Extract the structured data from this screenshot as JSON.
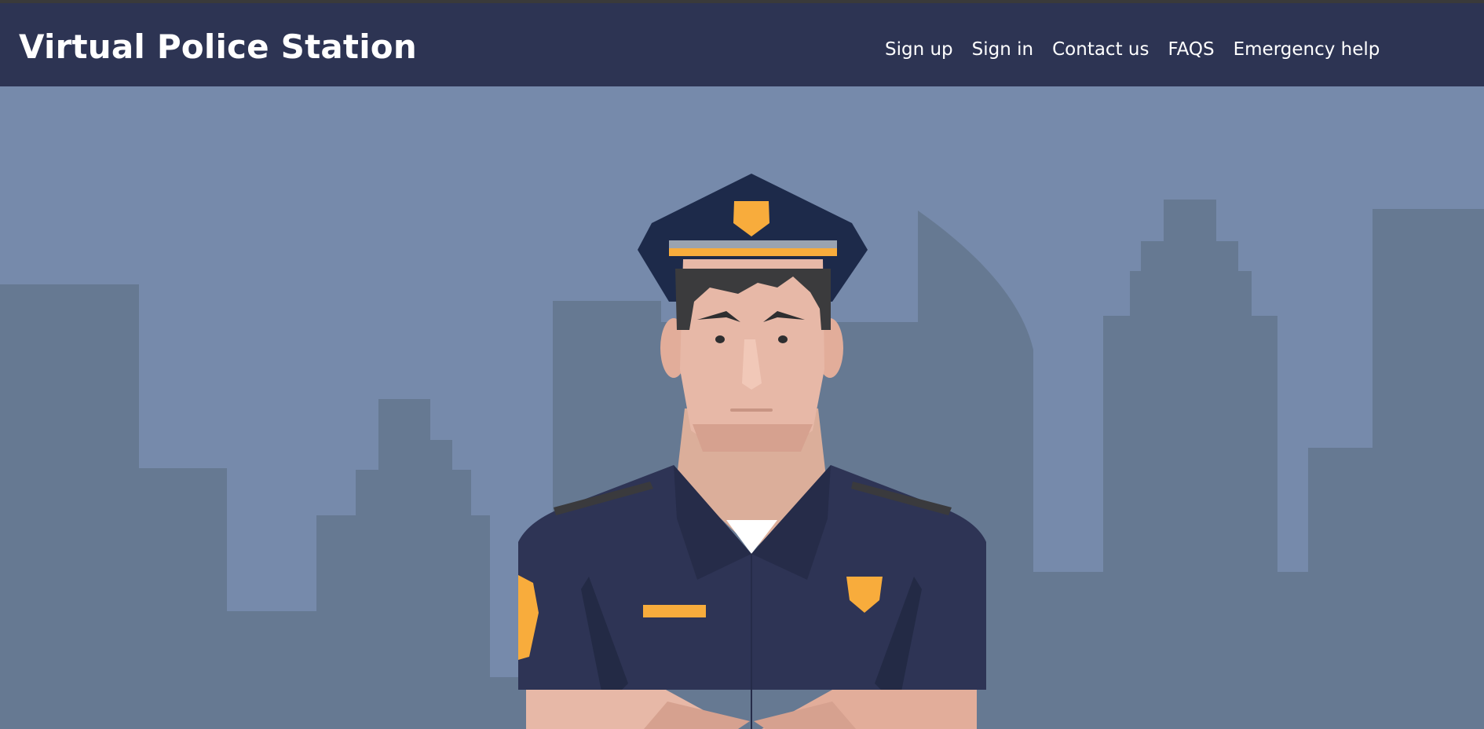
{
  "header": {
    "brand": "Virtual Police Station",
    "nav_links": [
      {
        "label": "Sign up"
      },
      {
        "label": "Sign in"
      },
      {
        "label": "Contact us"
      },
      {
        "label": "FAQS"
      },
      {
        "label": "Emergency help"
      }
    ]
  },
  "hero": {
    "illustration": "police-officer-city-skyline",
    "colors": {
      "navbar": "#2d3453",
      "sky": "#768aab",
      "buildings": "#667992",
      "uniform": "#2e3455",
      "badge": "#f8ac3c",
      "skin": "#e7b8a7"
    }
  }
}
